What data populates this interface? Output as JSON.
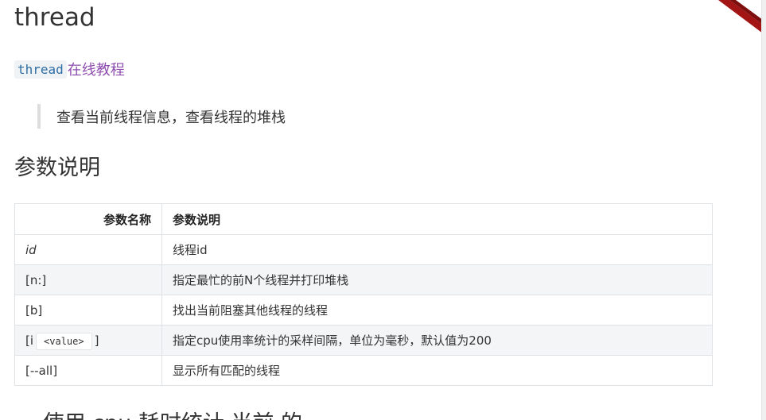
{
  "title": "thread",
  "tutorial": {
    "code": "thread",
    "text": "在线教程"
  },
  "summary": "查看当前线程信息，查看线程的堆栈",
  "section_title": "参数说明",
  "table": {
    "headers": [
      "参数名称",
      "参数说明"
    ],
    "rows": [
      {
        "name": "id",
        "desc": "线程id"
      },
      {
        "name": "[n:]",
        "desc": "指定最忙的前N个线程并打印堆栈"
      },
      {
        "name": "[b]",
        "desc": "找出当前阻塞其他线程的线程"
      },
      {
        "name_prefix": "[i",
        "name_code": "<value>",
        "name_suffix": "]",
        "desc": "指定cpu使用率统计的采样间隔，单位为毫秒，默认值为200"
      },
      {
        "name": "[--all]",
        "desc": "显示所有匹配的线程"
      }
    ]
  },
  "next_heading": "一 使用 cpu 耗时统计 当前 的",
  "colors": {
    "link": "#8f4fb0",
    "code": "#2e6da4",
    "ribbon": "#a31515"
  }
}
